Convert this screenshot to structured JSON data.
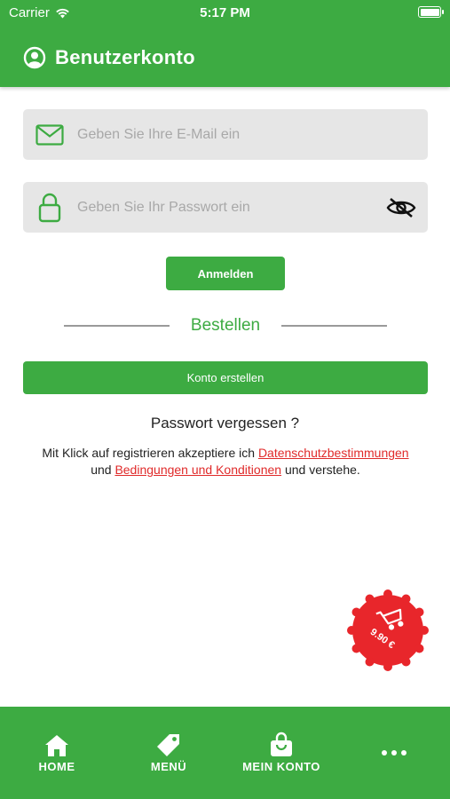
{
  "status_bar": {
    "carrier": "Carrier",
    "time": "5:17 PM"
  },
  "header": {
    "title": "Benutzerkonto",
    "icon": "user-circle-icon"
  },
  "login": {
    "email_placeholder": "Geben Sie Ihre E-Mail ein",
    "email_value": "",
    "password_placeholder": "Geben Sie Ihr Passwort ein",
    "password_value": "",
    "login_button": "Anmelden"
  },
  "divider": {
    "label": "Bestellen"
  },
  "create_account_button": "Konto erstellen",
  "forgot_password": "Passwort vergessen ?",
  "terms": {
    "prefix": "Mit Klick auf registrieren akzeptiere ich",
    "privacy_link": "Datenschutzbestimmungen",
    "and": "und",
    "conditions_link": "Bedingungen und Konditionen",
    "suffix": "und verstehe."
  },
  "cart": {
    "amount": "9.90 €",
    "color": "#e8262b"
  },
  "bottom_nav": {
    "items": [
      {
        "label": "HOME",
        "icon": "home-icon"
      },
      {
        "label": "MENÜ",
        "icon": "tag-icon"
      },
      {
        "label": "MEIN KONTO",
        "icon": "shopping-bag-icon"
      }
    ],
    "more_icon": "more-dots-icon"
  },
  "colors": {
    "brand_green": "#3dab42",
    "link_red": "#e02a2a",
    "field_bg": "#e6e6e6"
  }
}
